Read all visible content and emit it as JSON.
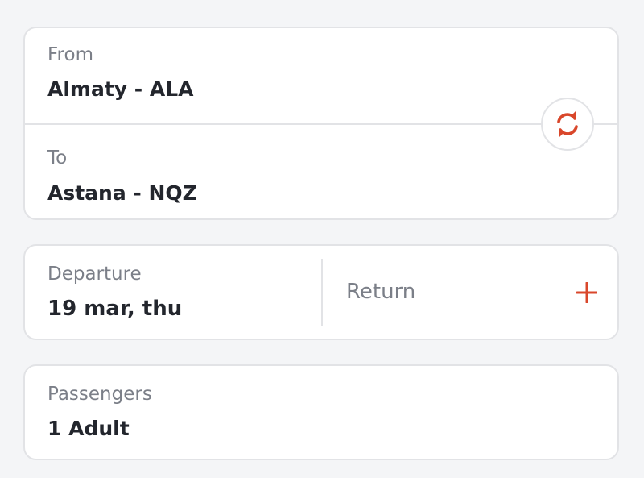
{
  "route": {
    "from_label": "From",
    "from_value": "Almaty - ALA",
    "to_label": "To",
    "to_value": "Astana - NQZ",
    "swap_icon": "swap-arrows-icon"
  },
  "dates": {
    "departure_label": "Departure",
    "departure_value": "19 mar, thu",
    "return_label": "Return",
    "add_icon": "plus-icon"
  },
  "passengers": {
    "label": "Passengers",
    "value": "1 Adult"
  },
  "colors": {
    "accent": "#d9472b",
    "card_border": "#e2e3e6",
    "background": "#f4f5f7",
    "label_text": "#7b7f88",
    "value_text": "#23262d"
  }
}
